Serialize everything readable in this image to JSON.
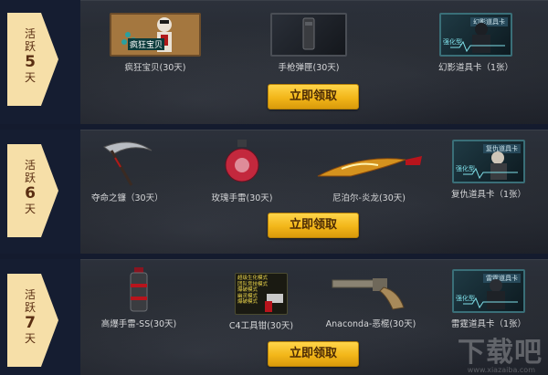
{
  "rows": [
    {
      "stage_top": "活",
      "stage_mid": "跃",
      "stage_num": "5",
      "stage_bot": "天",
      "items": [
        {
          "label": "疯狂宝贝(30天)",
          "overlay": "疯狂宝贝"
        },
        {
          "label": "手枪弹匣(30天)"
        },
        {
          "label": "幻影道具卡（1张）",
          "tag": "幻影道具卡",
          "side": "强化型"
        }
      ],
      "button": "立即领取"
    },
    {
      "stage_top": "活",
      "stage_mid": "跃",
      "stage_num": "6",
      "stage_bot": "天",
      "items": [
        {
          "label": "夺命之镰（30天）"
        },
        {
          "label": "玫瑰手雷(30天)"
        },
        {
          "label": "尼泊尔-炎龙(30天)"
        },
        {
          "label": "复仇道具卡（1张）",
          "tag": "复仇道具卡",
          "side": "强化型"
        }
      ],
      "button": "立即领取"
    },
    {
      "stage_top": "活",
      "stage_mid": "跃",
      "stage_num": "7",
      "stage_bot": "天",
      "items": [
        {
          "label": "高爆手雷-SS(30天)"
        },
        {
          "label": "C4工具钳(30天)",
          "lines": [
            "超级生化模式",
            "团队竞技模式",
            "爆破模式",
            "幽灵模式",
            "爆破模式"
          ]
        },
        {
          "label": "Anaconda-恶棍(30天)"
        },
        {
          "label": "雷霆道具卡（1张）",
          "tag": "雷霆道具卡",
          "side": "强化型"
        }
      ],
      "button": "立即领取"
    }
  ],
  "watermark": "下载吧",
  "watermark_url": "www.xiazaiba.com",
  "colors": {
    "accent_button": "#f2b619",
    "marker": "#f6dfa8",
    "background": "#151d31"
  }
}
